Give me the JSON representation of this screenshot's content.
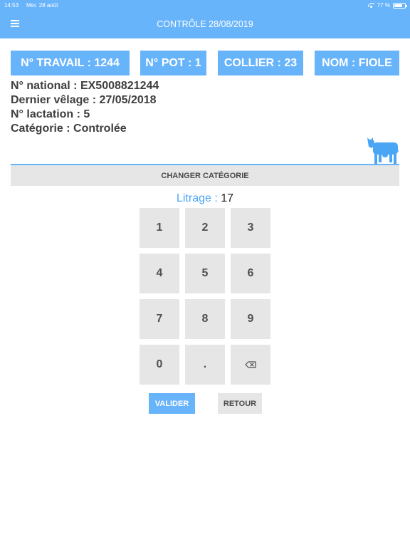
{
  "status_bar": {
    "time": "14:53",
    "date": "Mer. 28 août",
    "battery": "77 %",
    "battery_level": 0.77
  },
  "header": {
    "title": "CONTRÔLE 28/08/2019",
    "menu_icon": "hamburger-menu-icon"
  },
  "info_boxes": {
    "travail": "N° TRAVAIL : 1244",
    "pot": "N° POT : 1",
    "collier": "COLLIER : 23",
    "nom": "NOM : FIOLE"
  },
  "animal": {
    "national": "N° national : EX5008821244",
    "velage": "Dernier vêlage : 27/05/2018",
    "lactation": "N° lactation : 5",
    "categorie": "Catégorie : Controlée",
    "icon": "cow-icon"
  },
  "actions": {
    "change_category": "CHANGER CATÉGORIE",
    "validate": "VALIDER",
    "back": "RETOUR"
  },
  "litrage": {
    "label": "Litrage : ",
    "value": "17"
  },
  "keypad": {
    "keys": [
      "1",
      "2",
      "3",
      "4",
      "5",
      "6",
      "7",
      "8",
      "9",
      "0",
      "."
    ],
    "backspace_icon": "backspace-icon"
  },
  "colors": {
    "accent": "#68b4fb",
    "key_background": "#e6e6e6",
    "text": "#3f3f3f"
  }
}
